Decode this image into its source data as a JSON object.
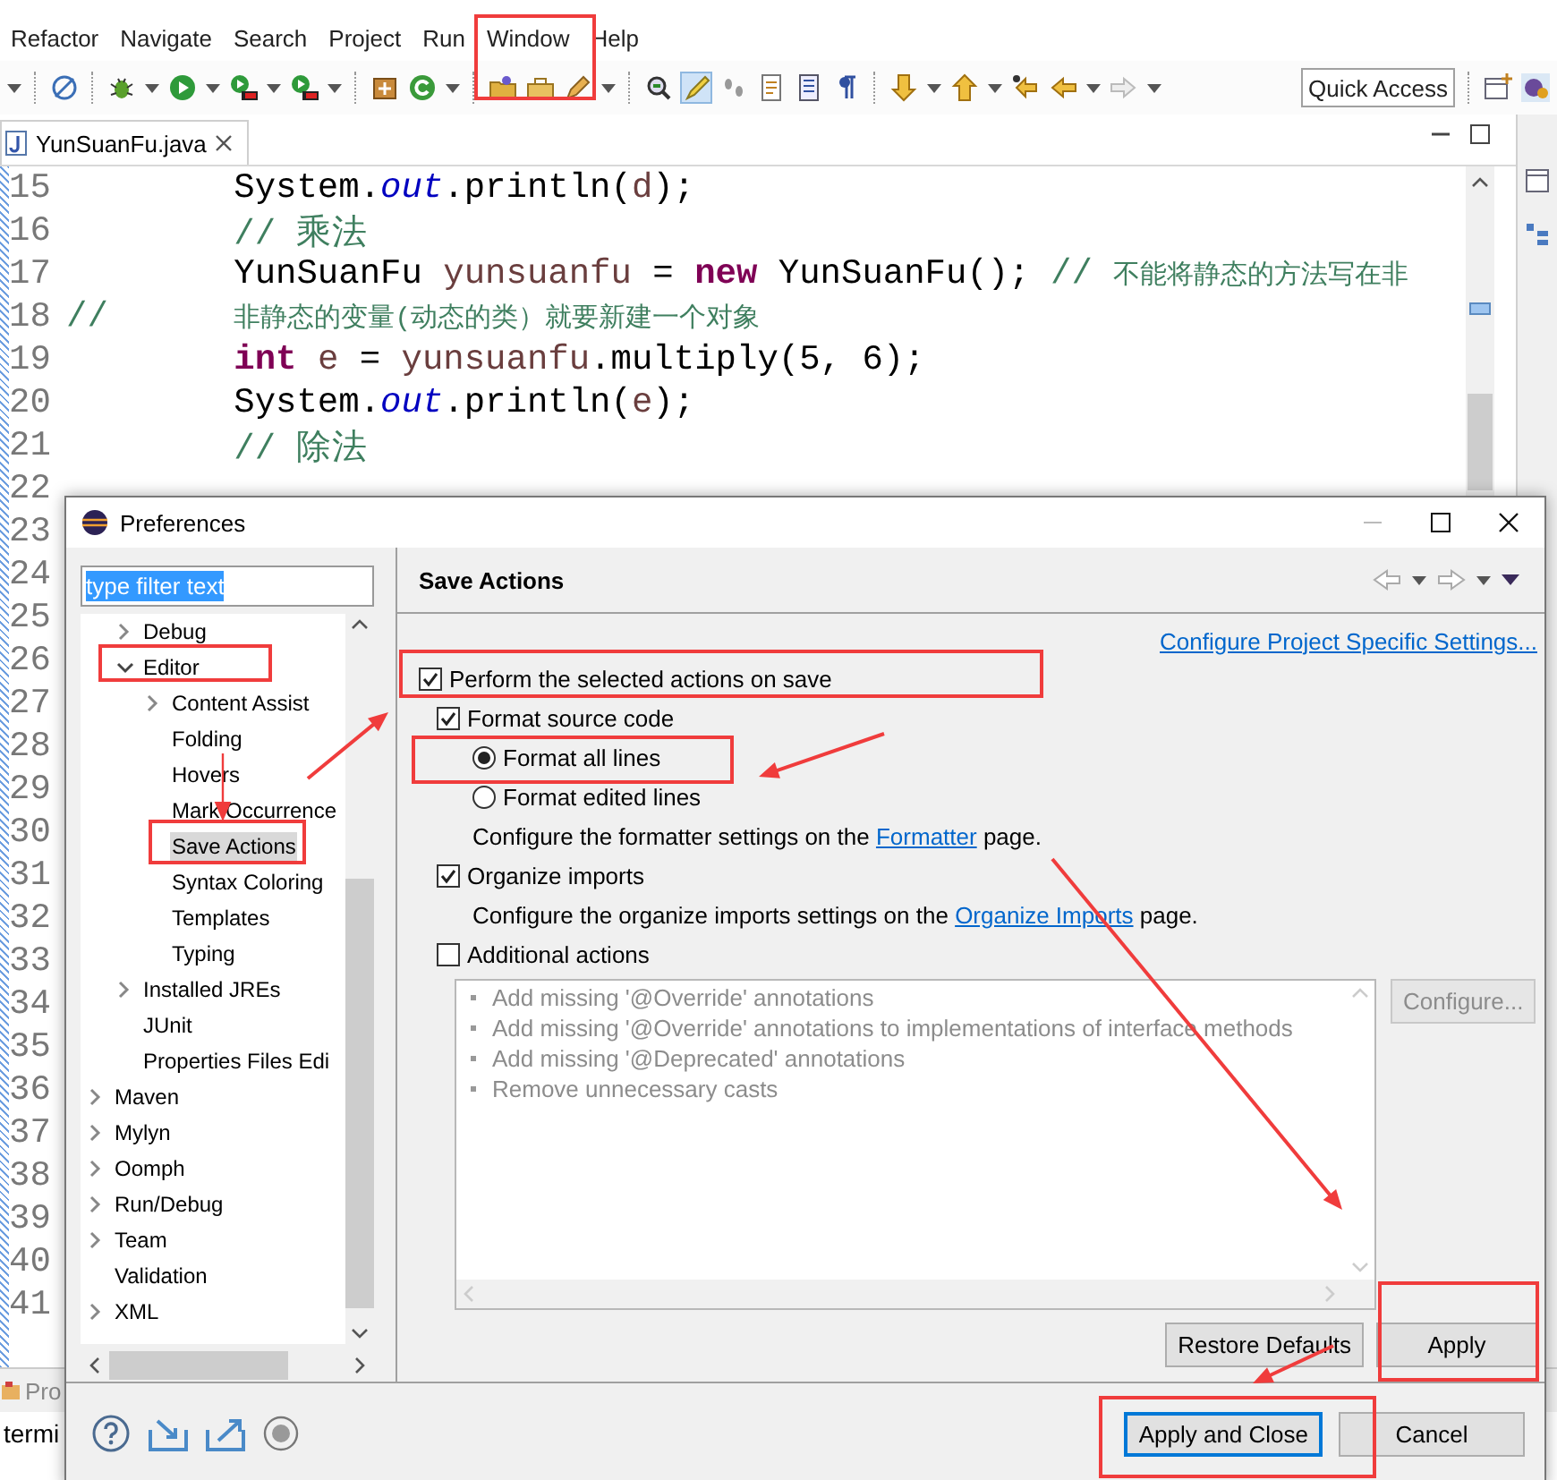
{
  "editor_window": {
    "menu": [
      "Refactor",
      "Navigate",
      "Search",
      "Project",
      "Run",
      "Window",
      "Help"
    ],
    "quick_access": {
      "placeholder": "Quick Access"
    },
    "editor_tab": {
      "title": "YunSuanFu.java"
    },
    "code_lines": [
      {
        "number": "15",
        "tokens": [
          {
            "text": "        System.",
            "kind": "plain"
          },
          {
            "text": "out",
            "kind": "static-field"
          },
          {
            "text": ".println(",
            "kind": "plain"
          },
          {
            "text": "d",
            "kind": "local-variable"
          },
          {
            "text": ");",
            "kind": "plain"
          }
        ]
      },
      {
        "number": "16",
        "tokens": [
          {
            "text": "        // 乘法",
            "kind": "comment"
          }
        ]
      },
      {
        "number": "17",
        "tokens": [
          {
            "text": "        YunSuanFu ",
            "kind": "plain"
          },
          {
            "text": "yunsuanfu",
            "kind": "local-variable"
          },
          {
            "text": " = ",
            "kind": "plain"
          },
          {
            "text": "new",
            "kind": "keyword"
          },
          {
            "text": " YunSuanFu(); ",
            "kind": "plain"
          },
          {
            "text": "// ",
            "kind": "comment"
          },
          {
            "text": "不能将静态的方法写在非",
            "kind": "comment-small"
          }
        ]
      },
      {
        "number": "18",
        "tokens": [
          {
            "text": "//      ",
            "kind": "comment"
          },
          {
            "text": "非静态的变量(动态的类）就要新建一个对象",
            "kind": "comment-small"
          }
        ]
      },
      {
        "number": "19",
        "tokens": [
          {
            "text": "        int ",
            "kind": "keyword"
          },
          {
            "text": "e",
            "kind": "local-variable"
          },
          {
            "text": " = ",
            "kind": "plain"
          },
          {
            "text": "yunsuanfu",
            "kind": "local-variable"
          },
          {
            "text": ".multiply(5, 6);",
            "kind": "plain"
          }
        ]
      },
      {
        "number": "20",
        "tokens": [
          {
            "text": "        System.",
            "kind": "plain"
          },
          {
            "text": "out",
            "kind": "static-field"
          },
          {
            "text": ".println(",
            "kind": "plain"
          },
          {
            "text": "e",
            "kind": "local-variable"
          },
          {
            "text": ");",
            "kind": "plain"
          }
        ]
      },
      {
        "number": "21",
        "tokens": [
          {
            "text": "        // 除法",
            "kind": "comment"
          }
        ]
      },
      {
        "number": "22"
      },
      {
        "number": "23"
      },
      {
        "number": "24"
      },
      {
        "number": "25"
      },
      {
        "number": "26"
      },
      {
        "number": "27"
      },
      {
        "number": "28"
      },
      {
        "number": "29"
      },
      {
        "number": "30"
      },
      {
        "number": "31"
      },
      {
        "number": "32"
      },
      {
        "number": "33"
      },
      {
        "number": "34"
      },
      {
        "number": "35"
      },
      {
        "number": "36"
      },
      {
        "number": "37"
      },
      {
        "number": "38"
      },
      {
        "number": "39"
      },
      {
        "number": "40"
      },
      {
        "number": "41"
      }
    ],
    "bottom_panel": {
      "tab": "Pro",
      "text": "termi"
    }
  },
  "dialog": {
    "title": "Preferences",
    "filter": {
      "value": "type filter text",
      "highlighted": true
    },
    "tree": [
      {
        "children": [
          {
            "label": "Debug",
            "kind": "collapsed",
            "selected": false
          },
          {
            "label": "Editor",
            "kind": "expanded",
            "selected": false,
            "children": [
              {
                "label": "Content Assist",
                "kind": "collapsed",
                "selected": false
              },
              {
                "label": "Folding",
                "kind": "leaf",
                "selected": false
              },
              {
                "label": "Hovers",
                "kind": "leaf",
                "selected": false
              },
              {
                "label": "Mark Occurrence",
                "kind": "leaf",
                "selected": false
              },
              {
                "label": "Save Actions",
                "kind": "leaf",
                "selected": true
              },
              {
                "label": "Syntax Coloring",
                "kind": "leaf",
                "selected": false
              },
              {
                "label": "Templates",
                "kind": "leaf",
                "selected": false
              },
              {
                "label": "Typing",
                "kind": "leaf",
                "selected": false
              }
            ]
          },
          {
            "label": "Installed JREs",
            "kind": "collapsed",
            "selected": false
          },
          {
            "label": "JUnit",
            "kind": "leaf",
            "selected": false
          },
          {
            "label": "Properties Files Edi",
            "kind": "leaf",
            "selected": false
          }
        ]
      },
      {
        "label": "Maven",
        "kind": "collapsed",
        "selected": false
      },
      {
        "label": "Mylyn",
        "kind": "collapsed",
        "selected": false
      },
      {
        "label": "Oomph",
        "kind": "collapsed",
        "selected": false
      },
      {
        "label": "Run/Debug",
        "kind": "collapsed",
        "selected": false
      },
      {
        "label": "Team",
        "kind": "collapsed",
        "selected": false
      },
      {
        "label": "Validation",
        "kind": "leaf",
        "selected": false
      },
      {
        "label": "XML",
        "kind": "collapsed",
        "selected": false
      }
    ],
    "page_title": "Save Actions",
    "project_settings_link": "Configure Project Specific Settings...",
    "options": [
      {
        "kind": "checkbox",
        "label": "Perform the selected actions on save",
        "checked": true,
        "children": [
          {
            "kind": "checkbox",
            "label": "Format source code",
            "checked": true,
            "children": [
              {
                "kind": "radio",
                "label": "Format all lines",
                "selected": true
              },
              {
                "kind": "radio",
                "label": "Format edited lines",
                "selected": false
              },
              {
                "kind": "note",
                "text": "Configure the formatter settings on the",
                "link": "Formatter",
                "after": "page."
              }
            ]
          },
          {
            "kind": "checkbox",
            "label": "Organize imports",
            "checked": true,
            "children": [
              {
                "kind": "note",
                "text": "Configure the organize imports settings on the",
                "link": "Organize Imports",
                "after": "page."
              }
            ]
          },
          {
            "kind": "checkbox",
            "label": "Additional actions",
            "checked": false
          }
        ]
      }
    ],
    "additional_list": {
      "disabled": true,
      "items": [
        "Add missing '@Override' annotations",
        "Add missing '@Override' annotations to implementations of interface methods",
        "Add missing '@Deprecated' annotations",
        "Remove unnecessary casts"
      ]
    },
    "configure_button": {
      "label": "Configure...",
      "disabled": true
    },
    "page_buttons": [
      "Restore Defaults",
      "Apply"
    ],
    "footer_buttons": [
      {
        "label": "Apply and Close",
        "default": true
      },
      {
        "label": "Cancel",
        "default": false
      }
    ]
  }
}
